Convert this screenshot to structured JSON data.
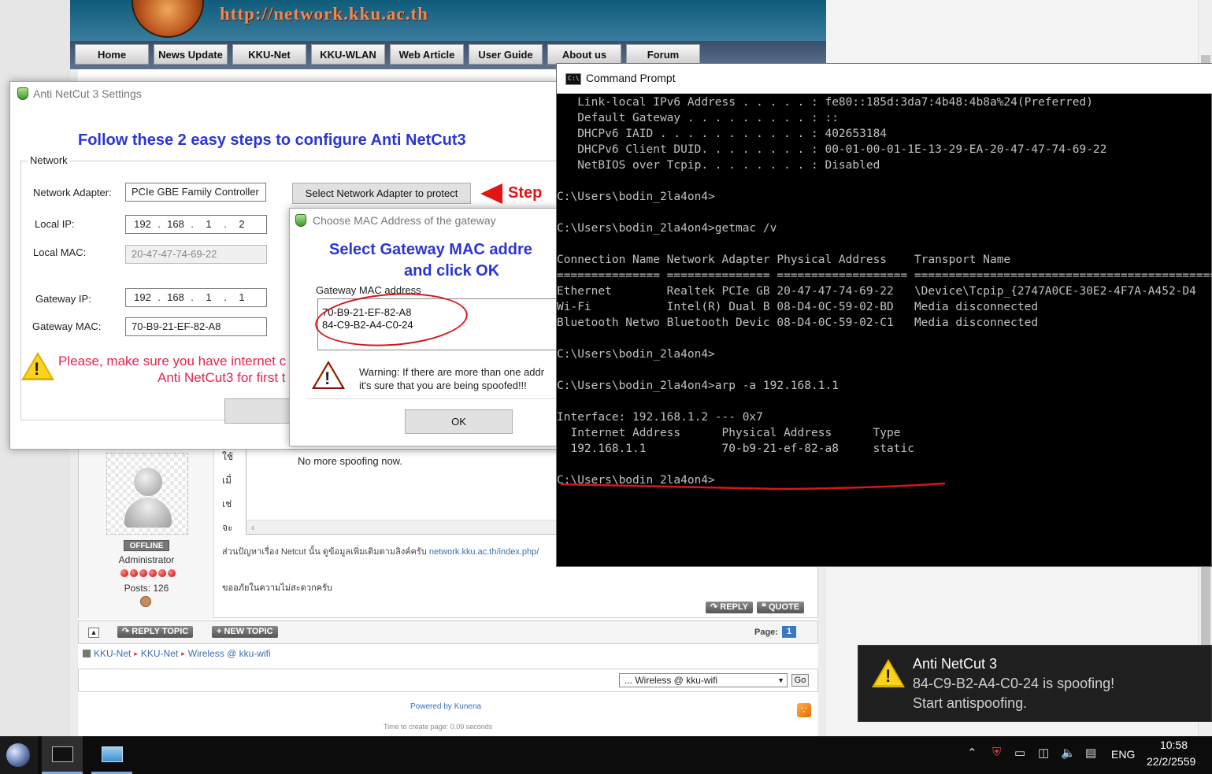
{
  "website": {
    "url_banner": "http://network.kku.ac.th",
    "nav": [
      "Home",
      "News Update",
      "KKU-Net",
      "KKU-WLAN",
      "Web Article",
      "User Guide",
      "About us",
      "Forum"
    ],
    "post": {
      "quote_text": "No more spoofing now.",
      "thai_line_1": "ใช้",
      "thai_line_2": "เมื่",
      "thai_line_3": "เช่",
      "thai_line_4": "จะ",
      "more_info_text": "ส่วนปัญหาเรื่อง Netcut นั้น ดูข้อมูลเพิ่มเติมตามลิงค์ครับ ",
      "more_info_link": "network.kku.ac.th/index.php/",
      "apology": "ขออภัยในความไม่สะดวกครับ",
      "reply_button": "REPLY",
      "quote_button": "QUOTE"
    },
    "profile": {
      "status": "OFFLINE",
      "role": "Administrator",
      "posts": "Posts: 126"
    },
    "topic_bar": {
      "reply_topic": "REPLY TOPIC",
      "new_topic": "NEW TOPIC",
      "page_label": "Page:",
      "page_number": "1"
    },
    "breadcrumb": [
      "KKU-Net",
      "KKU-Net",
      "Wireless @ kku-wifi"
    ],
    "jump": {
      "selected": "... Wireless @ kku-wifi",
      "go": "Go"
    },
    "powered_by": "Powered by Kunena",
    "time_to_create": "Time to create page: 0.09 seconds"
  },
  "settings_window": {
    "title": "Anti NetCut 3 Settings",
    "heading": "Follow these 2 easy steps to configure Anti NetCut3",
    "group_label": "Network",
    "network_adapter_label": "Network Adapter:",
    "network_adapter_value": "PCIe GBE Family Controller",
    "select_adapter_button": "Select Network Adapter to protect",
    "step_label": "Step",
    "local_ip_label": "Local IP:",
    "local_ip": [
      "192",
      "168",
      "1",
      "2"
    ],
    "local_mac_label": "Local MAC:",
    "local_mac_value": "20-47-47-74-69-22",
    "gateway_ip_label": "Gateway IP:",
    "gateway_ip": [
      "192",
      "168",
      "1",
      "1"
    ],
    "gateway_mac_label": "Gateway MAC:",
    "gateway_mac_value": "70-B9-21-EF-82-A8",
    "internet_warning_line1": "Please, make sure you have internet c",
    "internet_warning_line2": "Anti NetCut3 for first t"
  },
  "mac_dialog": {
    "title": "Choose MAC Address of the gateway",
    "heading_line1": "Select Gateway MAC addre",
    "heading_line2": "and click OK",
    "list_label": "Gateway MAC address",
    "mac_options": [
      "70-B9-21-EF-82-A8",
      "84-C9-B2-A4-C0-24"
    ],
    "warning_line1": "Warning: If there are more than one addr",
    "warning_line2": "it's sure that you are being spoofed!!!",
    "ok_button": "OK"
  },
  "command_prompt": {
    "title": "Command Prompt",
    "lines": [
      "   Link-local IPv6 Address . . . . . : fe80::185d:3da7:4b48:4b8a%24(Preferred)",
      "   Default Gateway . . . . . . . . . : ::",
      "   DHCPv6 IAID . . . . . . . . . . . : 402653184",
      "   DHCPv6 Client DUID. . . . . . . . : 00-01-00-01-1E-13-29-EA-20-47-47-74-69-22",
      "   NetBIOS over Tcpip. . . . . . . . : Disabled",
      "",
      "C:\\Users\\bodin_2la4on4>",
      "",
      "C:\\Users\\bodin_2la4on4>getmac /v",
      "",
      "Connection Name Network Adapter Physical Address    Transport Name",
      "=============== =============== =================== ==========================================================",
      "Ethernet        Realtek PCIe GB 20-47-47-74-69-22   \\Device\\Tcpip_{2747A0CE-30E2-4F7A-A452-D4",
      "Wi-Fi           Intel(R) Dual B 08-D4-0C-59-02-BD   Media disconnected",
      "Bluetooth Netwo Bluetooth Devic 08-D4-0C-59-02-C1   Media disconnected",
      "",
      "C:\\Users\\bodin_2la4on4>",
      "",
      "C:\\Users\\bodin_2la4on4>arp -a 192.168.1.1",
      "",
      "Interface: 192.168.1.2 --- 0x7",
      "  Internet Address      Physical Address      Type",
      "  192.168.1.1           70-b9-21-ef-82-a8     static",
      "",
      "C:\\Users\\bodin_2la4on4>"
    ]
  },
  "notification": {
    "title": "Anti NetCut 3",
    "line1": "84-C9-B2-A4-C0-24 is spoofing!",
    "line2": "Start antispoofing."
  },
  "taskbar": {
    "language": "ENG",
    "time": "10:58",
    "date": "22/2/2559"
  },
  "colors": {
    "heading_blue": "#2b35d6",
    "alert_red": "#e21414",
    "warning_pink": "#e8224e",
    "annotation_red": "#d8151b"
  }
}
